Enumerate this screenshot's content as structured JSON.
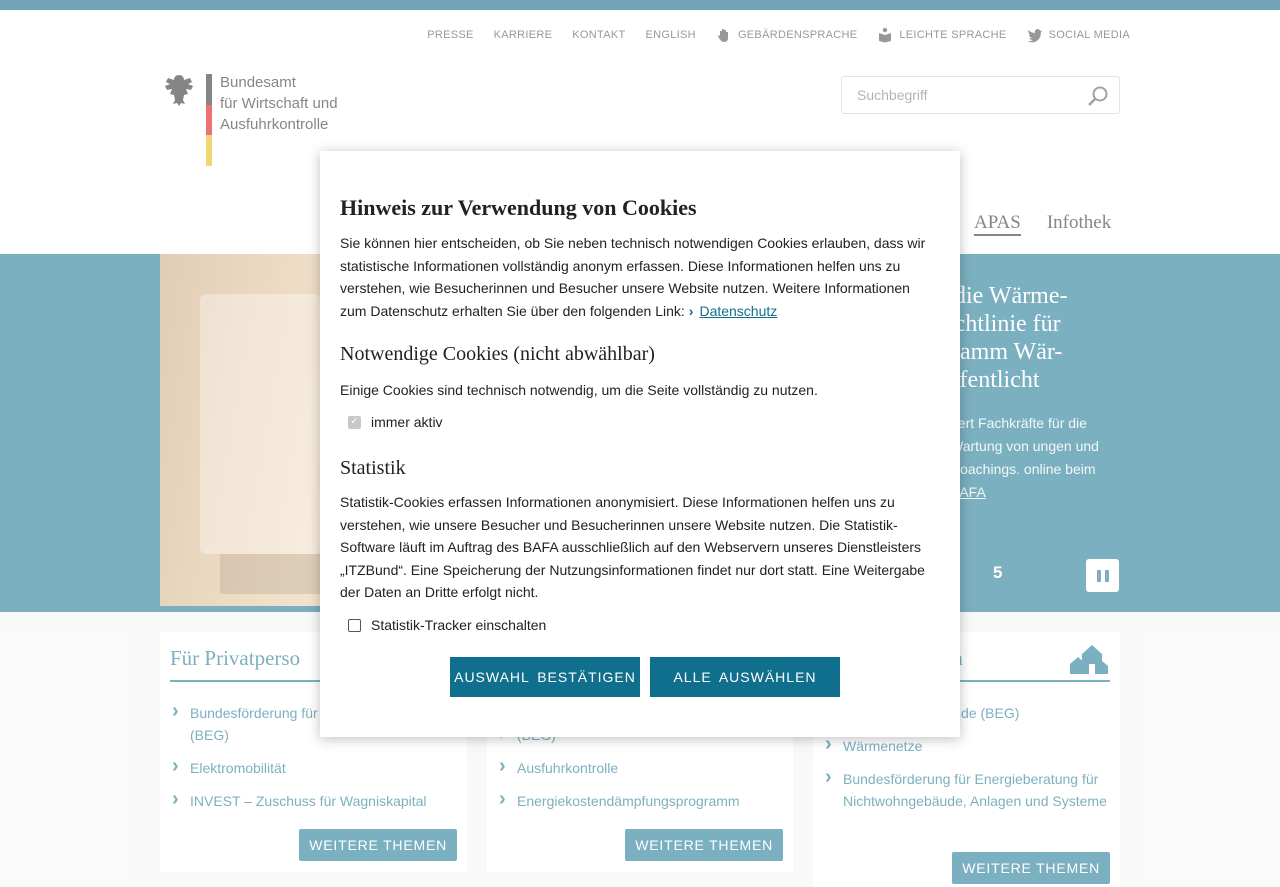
{
  "utility_nav": {
    "items": [
      {
        "label": "PRESSE"
      },
      {
        "label": "KARRIERE"
      },
      {
        "label": "KONTAKT"
      },
      {
        "label": "ENGLISH"
      },
      {
        "label": "GEBÄRDENSPRACHE",
        "icon": "hand-icon"
      },
      {
        "label": "LEICHTE SPRACHE",
        "icon": "book-icon"
      },
      {
        "label": "SOCIAL MEDIA",
        "icon": "bird-icon"
      }
    ]
  },
  "header": {
    "logo_lines": [
      "Bundesamt",
      "für Wirtschaft und",
      "Ausfuhrkontrolle"
    ],
    "search_placeholder": "Suchbegriff"
  },
  "main_nav": {
    "items": [
      {
        "label": "APAS"
      },
      {
        "label": "Infothek"
      }
    ]
  },
  "hero": {
    "headline": "r die Wärme- richtlinie für gramm Wär- öffentlicht",
    "teaser": "dert Fachkräfte für die Wartung von ungen und Coachings. online beim ",
    "teaser_link": "BAFA",
    "pager_number": "5"
  },
  "cards": [
    {
      "title": "Für Privatperso",
      "items": [
        "Bundesförderung für (BEG)",
        "Elektromobilität",
        "INVEST – Zuschuss für Wagniskapital"
      ],
      "more_label": "WEITERE THEMEN"
    },
    {
      "title": "",
      "items": [
        "(BEG)",
        "Ausfuhrkontrolle",
        "Energiekostendämpfungsprogramm"
      ],
      "more_label": "WEITERE THEMEN"
    },
    {
      "title": "en",
      "items": [
        "ür effiziente Gebäude (BEG)",
        "Wärmenetze",
        "Bundesförderung für Energieberatung für Nichtwohngebäude, Anlagen und Systeme"
      ],
      "more_label": "WEITERE THEMEN"
    }
  ],
  "cookie_modal": {
    "title": "Hinweis zur Verwendung von Cookies",
    "intro": "Sie können hier entscheiden, ob Sie neben technisch notwendigen Cookies erlauben, dass wir statistische Informationen vollständig anonym erfassen. Diese Informationen helfen uns zu verstehen, wie Besucherinnen und Besucher unsere Website nutzen. Weitere Informationen zum Datenschutz erhalten Sie über den folgenden Link:",
    "privacy_link": "Datenschutz",
    "necessary_heading": "Notwendige Cookies (nicht abwählbar)",
    "necessary_text": "Einige Cookies sind technisch notwendig, um die Seite vollständig zu nutzen.",
    "always_active_label": "immer aktiv",
    "statistics_heading": "Statistik",
    "statistics_text": "Statistik-Cookies erfassen Informationen anonymisiert. Diese Informationen helfen uns zu verstehen, wie unsere Besucher und Besucherinnen unsere Website nutzen. Die Statistik-Software läuft im Auftrag des BAFA ausschließlich auf den Webservern unseres Dienstleisters „ITZBund“. Eine Speicherung der Nutzungsinformationen findet nur dort statt. Eine Weitergabe der Daten an Dritte erfolgt nicht.",
    "statistics_checkbox_label": "Statistik-Tracker einschalten",
    "confirm_button": "AUSWAHL BESTÄTIGEN",
    "select_all_button": "ALLE AUSWÄHLEN"
  },
  "colors": {
    "accent": "#0f6f8c",
    "topbar": "#00587c"
  }
}
